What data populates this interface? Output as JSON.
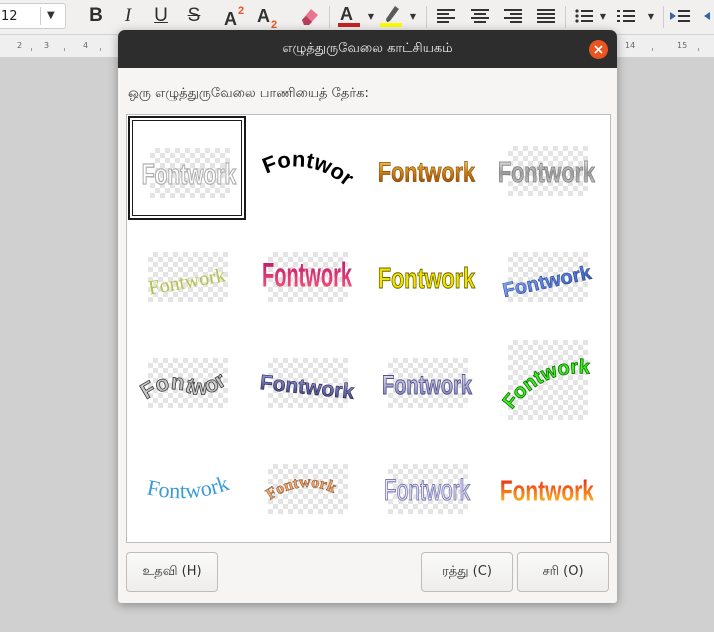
{
  "toolbar": {
    "font_size": "12",
    "buttons": [
      "bold",
      "italic",
      "underline",
      "strikethrough",
      "superscript",
      "subscript",
      "clear-formatting",
      "font-color",
      "highlight-color",
      "align-left",
      "align-center",
      "align-right",
      "justify",
      "unordered-list",
      "ordered-list",
      "increase-indent",
      "decrease-indent"
    ]
  },
  "ruler": {
    "numbers": [
      "2",
      "3",
      "4",
      "14",
      "15"
    ]
  },
  "dialog": {
    "title": "எழுத்துருவேலை காட்சியகம்",
    "prompt": "ஒரு எழுத்துருவேலை பாணியைத் தேர்க:",
    "gallery": {
      "items": [
        {
          "text": "Fontwork",
          "style": "outline-gray",
          "selected": true
        },
        {
          "text": "Fontwork",
          "style": "black-arch"
        },
        {
          "text": "Fontwork",
          "style": "gold-gradient"
        },
        {
          "text": "Fontwork",
          "style": "silver-gradient"
        },
        {
          "text": "Fontwork",
          "style": "olive-serif"
        },
        {
          "text": "Fontwork",
          "style": "pink-perspective"
        },
        {
          "text": "Fontwork",
          "style": "yellow-bold"
        },
        {
          "text": "Fontwork",
          "style": "blue-slant"
        },
        {
          "text": "Fontwork",
          "style": "gray-wave"
        },
        {
          "text": "Fontwork",
          "style": "purple-3d"
        },
        {
          "text": "Fontwork",
          "style": "lavender-bulge"
        },
        {
          "text": "Fontwork",
          "style": "green-arch"
        },
        {
          "text": "Fontwork",
          "style": "cyan-serif"
        },
        {
          "text": "Fontwork",
          "style": "orange-arc"
        },
        {
          "text": "Fontwork",
          "style": "lilac-outline"
        },
        {
          "text": "Fontwork",
          "style": "red-yellow"
        }
      ]
    },
    "buttons": {
      "help": "உதவி (H)",
      "cancel": "ரத்து (C)",
      "ok": "சரி (O)"
    }
  },
  "colors": {
    "titlebar": "#2d2d2d",
    "close_button": "#e95420",
    "font_color_bar": "#c9211e",
    "highlight_bar": "#ffff00"
  }
}
